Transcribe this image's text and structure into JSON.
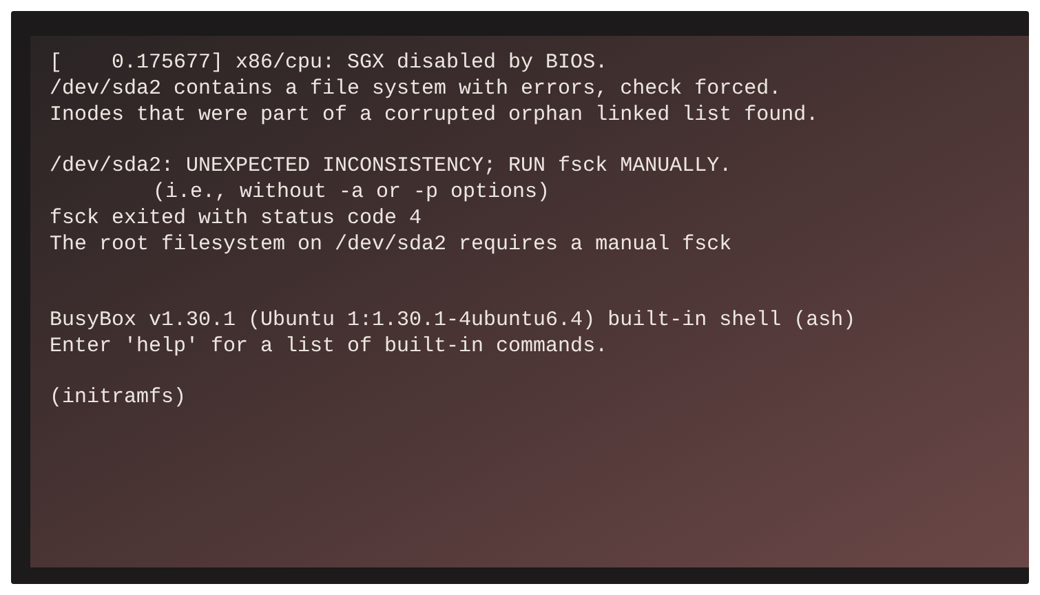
{
  "console": {
    "blocks": [
      [
        {
          "text": "[    0.175677] x86/cpu: SGX disabled by BIOS.",
          "kind": "plain"
        },
        {
          "text": "/dev/sda2 contains a file system with errors, check forced.",
          "kind": "plain"
        },
        {
          "text": "Inodes that were part of a corrupted orphan linked list found.",
          "kind": "plain"
        }
      ],
      [
        {
          "text": "/dev/sda2: UNEXPECTED INCONSISTENCY; RUN fsck MANUALLY.",
          "kind": "plain"
        },
        {
          "text": "(i.e., without -a or -p options)",
          "kind": "indented"
        },
        {
          "text": "fsck exited with status code 4",
          "kind": "plain"
        },
        {
          "text": "The root filesystem on /dev/sda2 requires a manual fsck",
          "kind": "plain"
        }
      ],
      [
        {
          "text": "BusyBox v1.30.1 (Ubuntu 1:1.30.1-4ubuntu6.4) built-in shell (ash)",
          "kind": "plain"
        },
        {
          "text": "Enter 'help' for a list of built-in commands.",
          "kind": "plain"
        }
      ],
      [
        {
          "text": "(initramfs)",
          "kind": "plain"
        }
      ]
    ]
  }
}
